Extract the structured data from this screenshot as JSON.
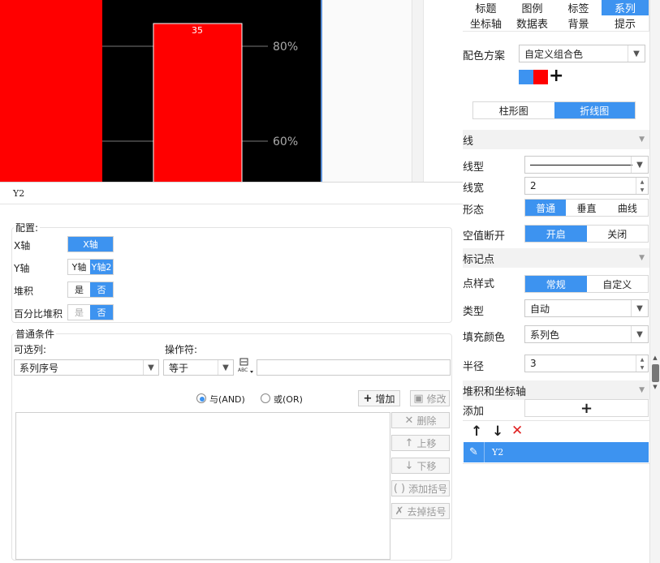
{
  "chart_data": {
    "type": "bar",
    "series": [
      {
        "name": "",
        "values": [
          35
        ]
      }
    ],
    "bar_label": "35",
    "y2_ticks": [
      "80%",
      "60%"
    ],
    "colors": {
      "bar": "#ff0000",
      "background": "#000000",
      "gridline": "#777777",
      "tick_text": "#aaaaaa"
    }
  },
  "dialog": {
    "title": "Y2",
    "config_group": "配置:",
    "x_axis_label": "X轴",
    "x_axis_value": "X轴",
    "y_axis_label": "Y轴",
    "y_axis_options": [
      "Y轴",
      "Y轴2"
    ],
    "stack_label": "堆积",
    "percent_stack_label": "百分比堆积",
    "yes": "是",
    "no": "否",
    "condition_group": "普通条件",
    "optional_column_label": "可选列:",
    "optional_column_value": "系列序号",
    "operator_label": "操作符:",
    "operator_value": "等于",
    "value_input": "",
    "and_label": "与(AND)",
    "or_label": "或(OR)",
    "add_button": "增加",
    "modify_button": "修改",
    "delete_button": "删除",
    "move_up_button": "上移",
    "move_down_button": "下移",
    "add_bracket_button": "添加括号",
    "remove_bracket_button": "去掉括号"
  },
  "panel": {
    "tabs": [
      "标题",
      "图例",
      "标签",
      "系列",
      "坐标轴",
      "数据表",
      "背景",
      "提示"
    ],
    "active_tab": "系列",
    "color_scheme_label": "配色方案",
    "color_scheme_value": "自定义组合色",
    "swatch_colors": [
      "#3d93f0",
      "#ff0000"
    ],
    "type_toggle": [
      "柱形图",
      "折线图"
    ],
    "line_section": "线",
    "line_type_label": "线型",
    "line_width_label": "线宽",
    "line_width_value": "2",
    "shape_label": "形态",
    "shape_options": [
      "普通",
      "垂直",
      "曲线"
    ],
    "null_break_label": "空值断开",
    "null_break_options": [
      "开启",
      "关闭"
    ],
    "marker_section": "标记点",
    "point_style_label": "点样式",
    "point_style_options": [
      "常规",
      "自定义"
    ],
    "marker_type_label": "类型",
    "marker_type_value": "自动",
    "fill_color_label": "填充颜色",
    "fill_color_value": "系列色",
    "radius_label": "半径",
    "radius_value": "3",
    "stack_axis_section": "堆积和坐标轴",
    "add_label": "添加",
    "list_item": "Y2"
  }
}
